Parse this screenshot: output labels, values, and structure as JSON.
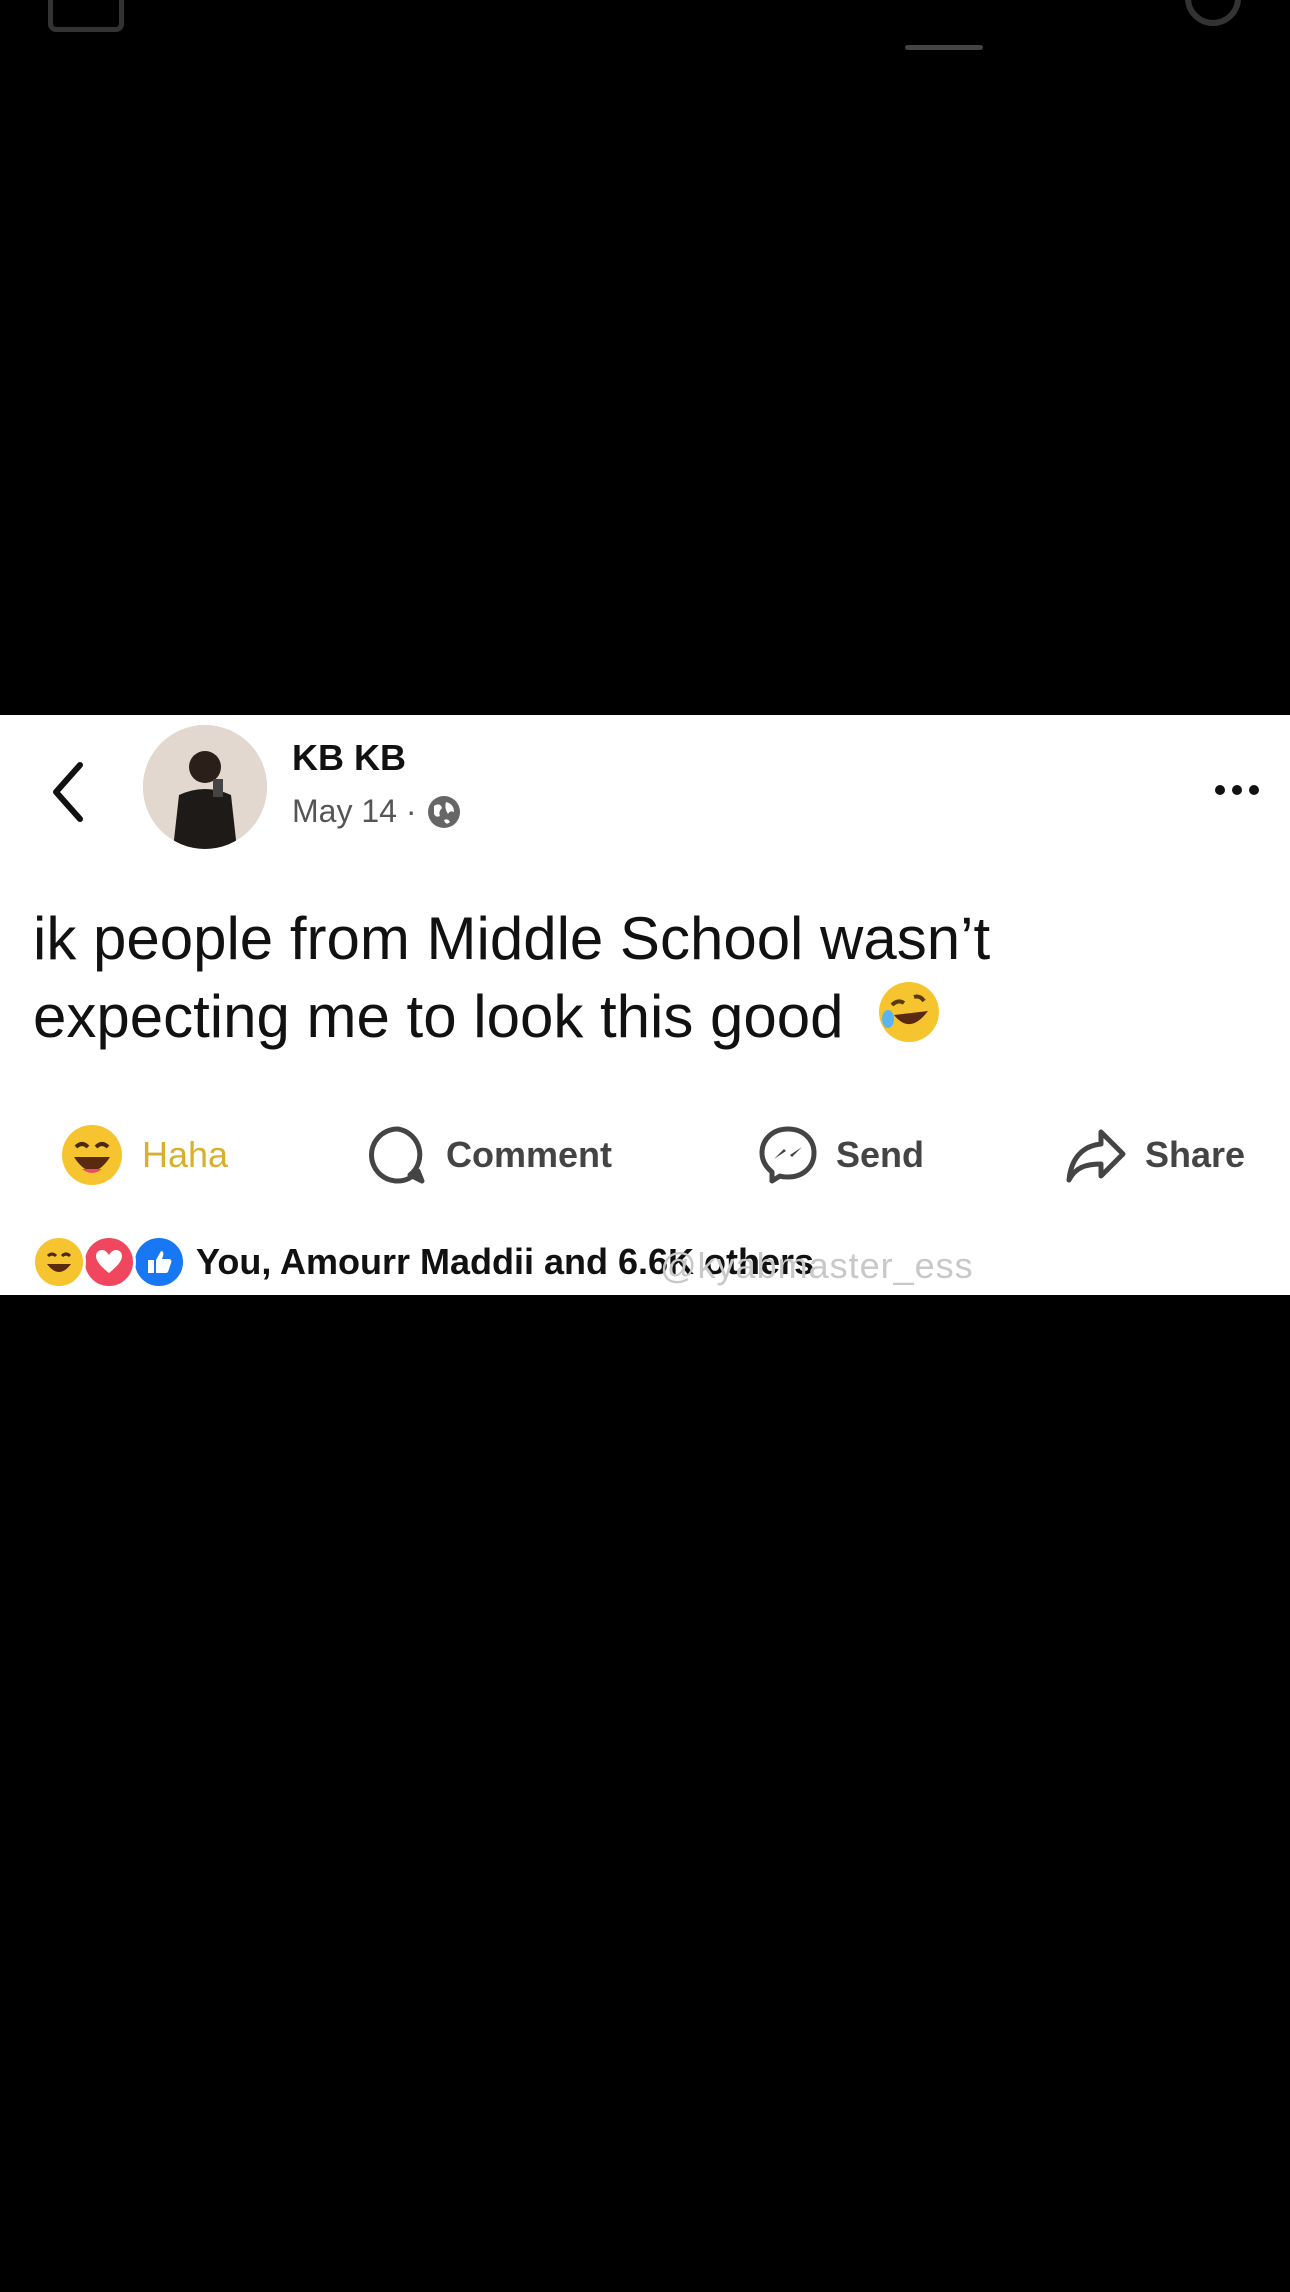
{
  "post": {
    "author": "KB KB",
    "date": "May 14 ·",
    "text": "ik people from Middle School wasn’t expecting me to look this good"
  },
  "actions": {
    "haha": "Haha",
    "comment": "Comment",
    "send": "Send",
    "share": "Share"
  },
  "reactions": {
    "summary": "You, Amourr Maddii and 6.6K others"
  },
  "watermark": "@kyabmaster_ess",
  "colors": {
    "haha": "#d8b02e",
    "background": "#000000",
    "card": "#ffffff"
  }
}
